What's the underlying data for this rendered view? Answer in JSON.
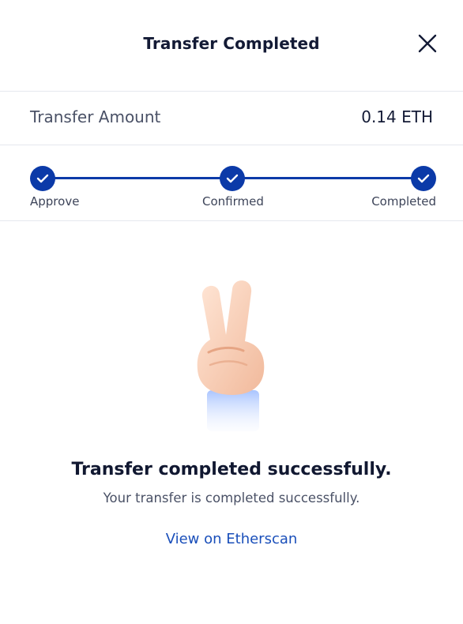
{
  "header": {
    "title": "Transfer Completed",
    "close_icon": "close-icon"
  },
  "amount": {
    "label": "Transfer Amount",
    "value": "0.14 ETH"
  },
  "steps": [
    {
      "label": "Approve",
      "status": "complete",
      "icon": "check-icon"
    },
    {
      "label": "Confirmed",
      "status": "complete",
      "icon": "check-icon"
    },
    {
      "label": "Completed",
      "status": "complete",
      "icon": "check-icon"
    }
  ],
  "result": {
    "illustration": "peace-hand-icon",
    "title": "Transfer completed successfully.",
    "subtitle": "Your transfer is completed successfully.",
    "link_label": "View on Etherscan"
  },
  "colors": {
    "accent": "#0b3aa8",
    "link": "#1a4fba",
    "text_primary": "#131a35",
    "text_secondary": "#4a5166",
    "divider": "#e6e8ee"
  }
}
